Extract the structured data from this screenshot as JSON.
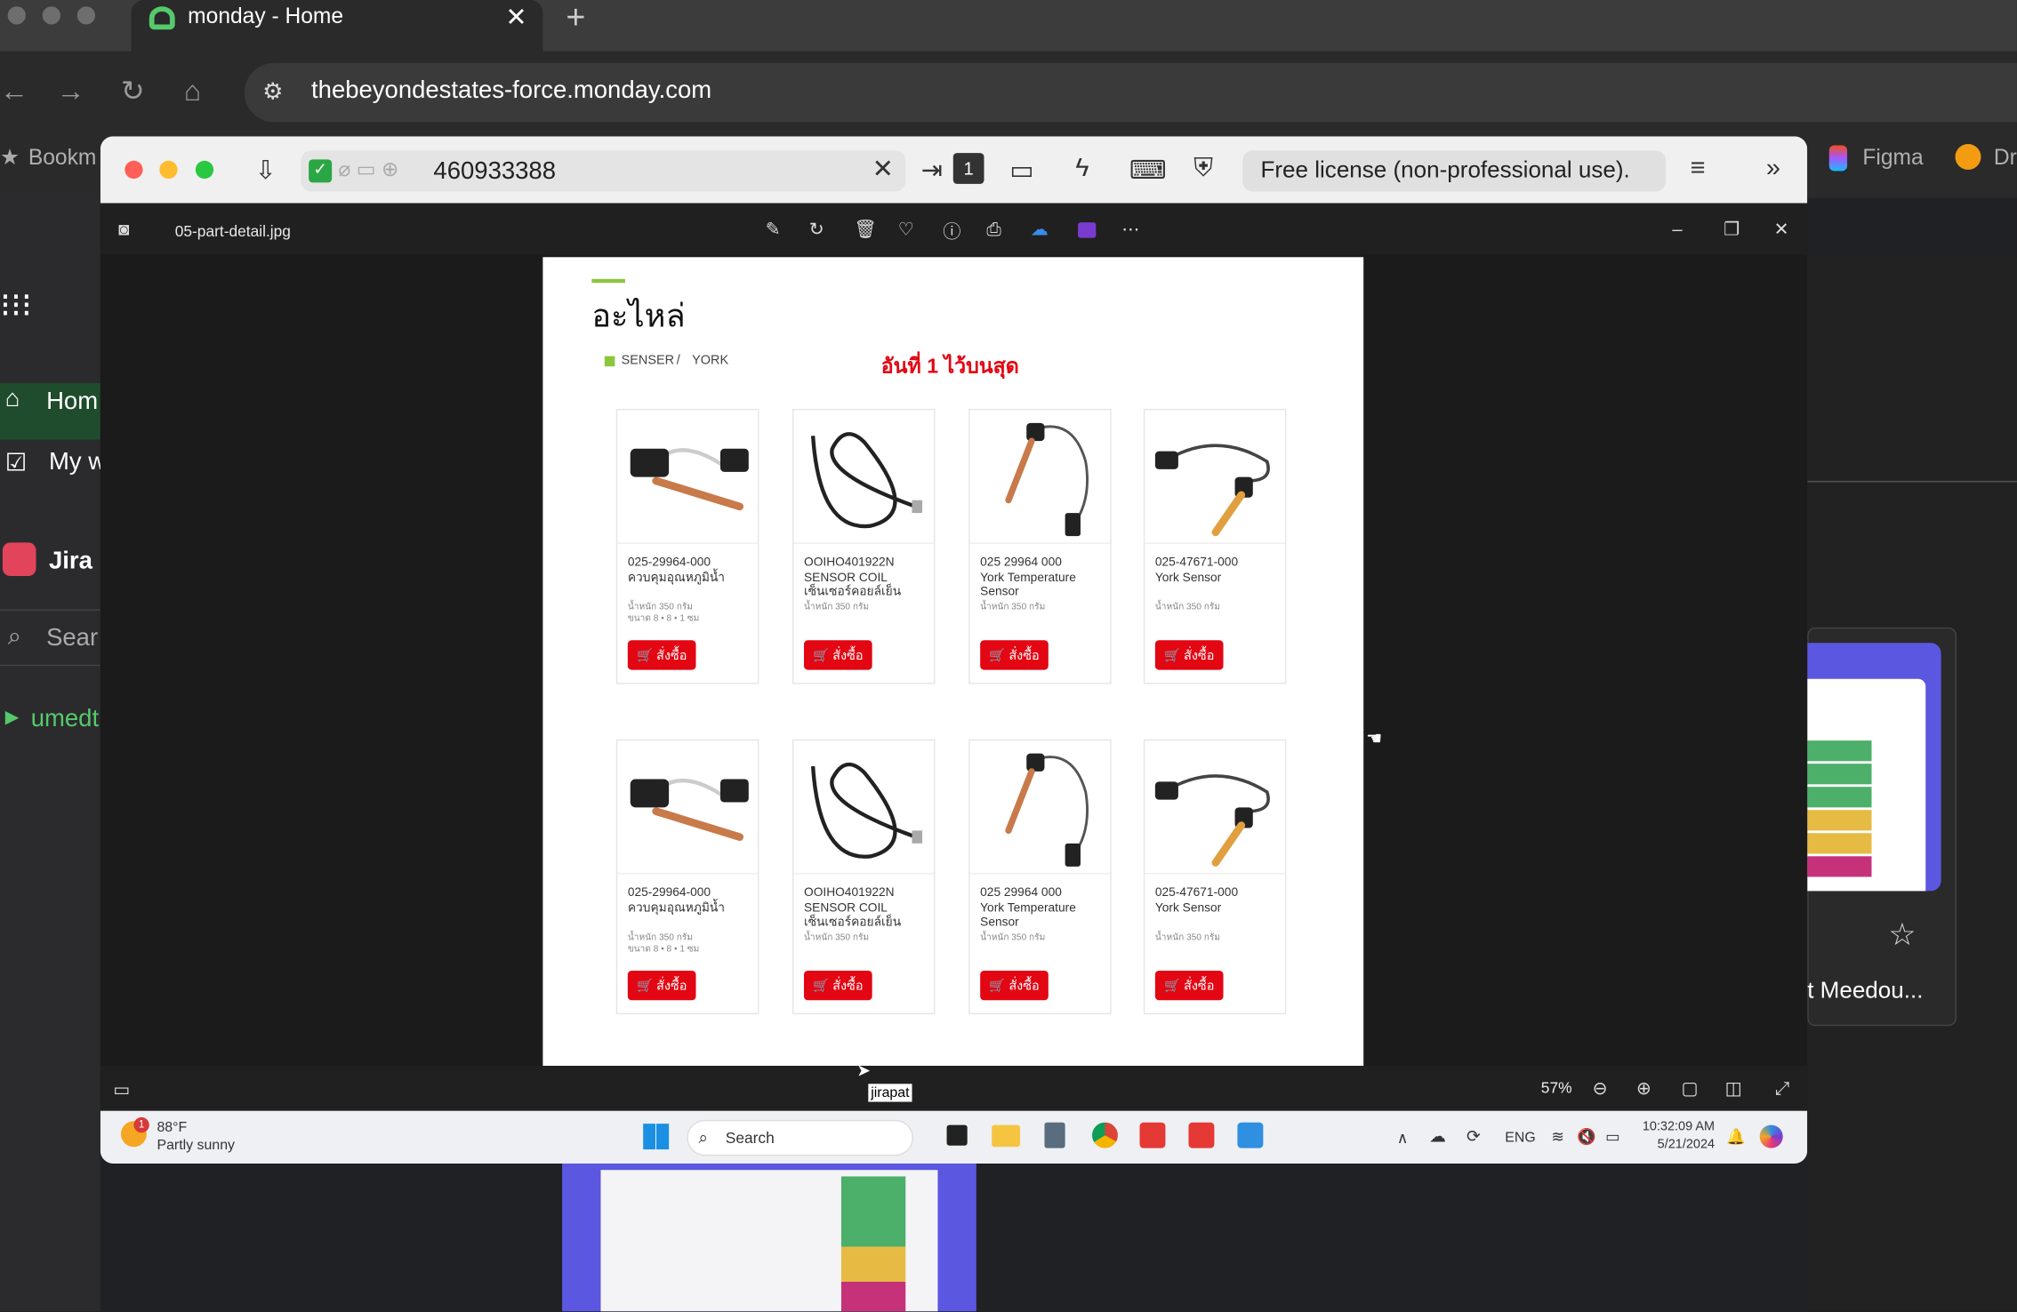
{
  "browser": {
    "tab_title": "monday - Home",
    "url": "thebeyondestates-force.monday.com",
    "bookmarks": [
      "Bookm",
      "Figma",
      "Dr"
    ]
  },
  "monday": {
    "home": "Hom",
    "my_work": "My w",
    "jira": "Jira",
    "search": "Sear",
    "workspace": "umedt",
    "card_label": "t Meedou..."
  },
  "viewer": {
    "session_id": "460933388",
    "license": "Free license (non-professional use).",
    "file_name": "05-part-detail.jpg",
    "zoom": "57%",
    "tooltip": "jirapat"
  },
  "document": {
    "title": "อะไหล่",
    "crumb1": "SENSER",
    "crumb_sep": "/",
    "crumb2": "YORK",
    "note": "อันที่ 1 ไว้บนสุด",
    "products": [
      {
        "code": "025-29964-000",
        "name": "ควบคุมอุณหภูมิน้ำ",
        "weight": "น้ำหนัก 350 กรัม",
        "size": "ขนาด 8 • 8 • 1 ซม",
        "button": "สั่งซื้อ"
      },
      {
        "code": "OOIHO401922N",
        "name": "SENSOR COIL เซ็นเซอร์คอยล์เย็น",
        "weight": "น้ำหนัก 350 กรัม",
        "size": "",
        "button": "สั่งซื้อ"
      },
      {
        "code": "025 29964 000",
        "name": "York Temperature Sensor",
        "weight": "น้ำหนัก 350 กรัม",
        "size": "",
        "button": "สั่งซื้อ"
      },
      {
        "code": "025-47671-000",
        "name": "York Sensor",
        "weight": "น้ำหนัก 350 กรัม",
        "size": "",
        "button": "สั่งซื้อ"
      },
      {
        "code": "025-29964-000",
        "name": "ควบคุมอุณหภูมิน้ำ",
        "weight": "น้ำหนัก 350 กรัม",
        "size": "ขนาด 8 • 8 • 1 ซม",
        "button": "สั่งซื้อ"
      },
      {
        "code": "OOIHO401922N",
        "name": "SENSOR COIL เซ็นเซอร์คอยล์เย็น",
        "weight": "น้ำหนัก 350 กรัม",
        "size": "",
        "button": "สั่งซื้อ"
      },
      {
        "code": "025 29964 000",
        "name": "York Temperature Sensor",
        "weight": "น้ำหนัก 350 กรัม",
        "size": "",
        "button": "สั่งซื้อ"
      },
      {
        "code": "025-47671-000",
        "name": "York Sensor",
        "weight": "น้ำหนัก 350 กรัม",
        "size": "",
        "button": "สั่งซื้อ"
      }
    ]
  },
  "taskbar": {
    "temp": "88°F",
    "weather": "Partly sunny",
    "weather_badge": "1",
    "search": "Search",
    "lang": "ENG",
    "time": "10:32:09 AM",
    "date": "5/21/2024"
  }
}
